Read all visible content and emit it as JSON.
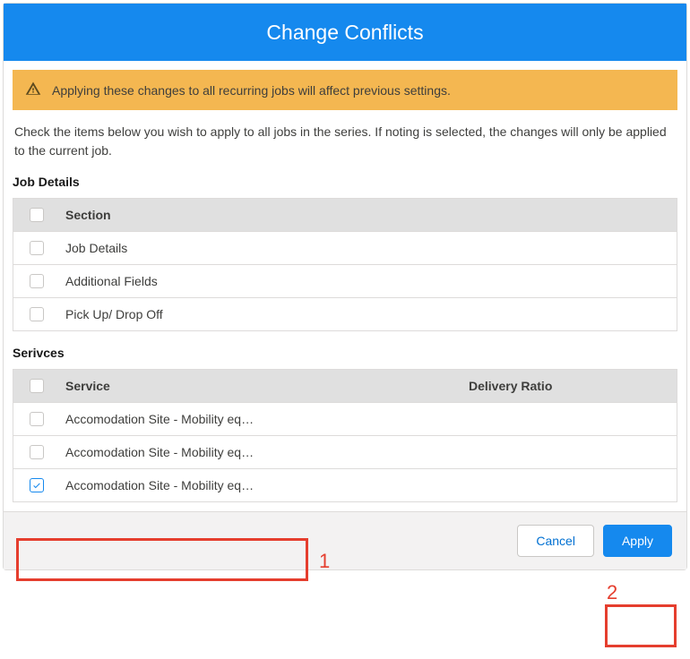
{
  "header": {
    "title": "Change Conflicts"
  },
  "alert": {
    "text": "Applying these changes to all recurring jobs will affect previous settings."
  },
  "description": "Check the items below you wish to apply to all jobs in the series. If noting is selected, the changes will only be applied to the current job.",
  "job_details": {
    "title": "Job Details",
    "column_header": "Section",
    "rows": [
      {
        "label": "Job Details",
        "checked": false
      },
      {
        "label": "Additional Fields",
        "checked": false
      },
      {
        "label": "Pick Up/ Drop Off",
        "checked": false
      }
    ]
  },
  "services": {
    "title": "Serivces",
    "columns": {
      "service": "Service",
      "ratio": "Delivery Ratio"
    },
    "rows": [
      {
        "service": "Accomodation Site - Mobility eq…",
        "ratio": "",
        "checked": false
      },
      {
        "service": "Accomodation Site - Mobility eq…",
        "ratio": "",
        "checked": false
      },
      {
        "service": "Accomodation Site - Mobility eq…",
        "ratio": "",
        "checked": true
      }
    ]
  },
  "footer": {
    "cancel": "Cancel",
    "apply": "Apply"
  },
  "annotations": {
    "one": "1",
    "two": "2"
  }
}
